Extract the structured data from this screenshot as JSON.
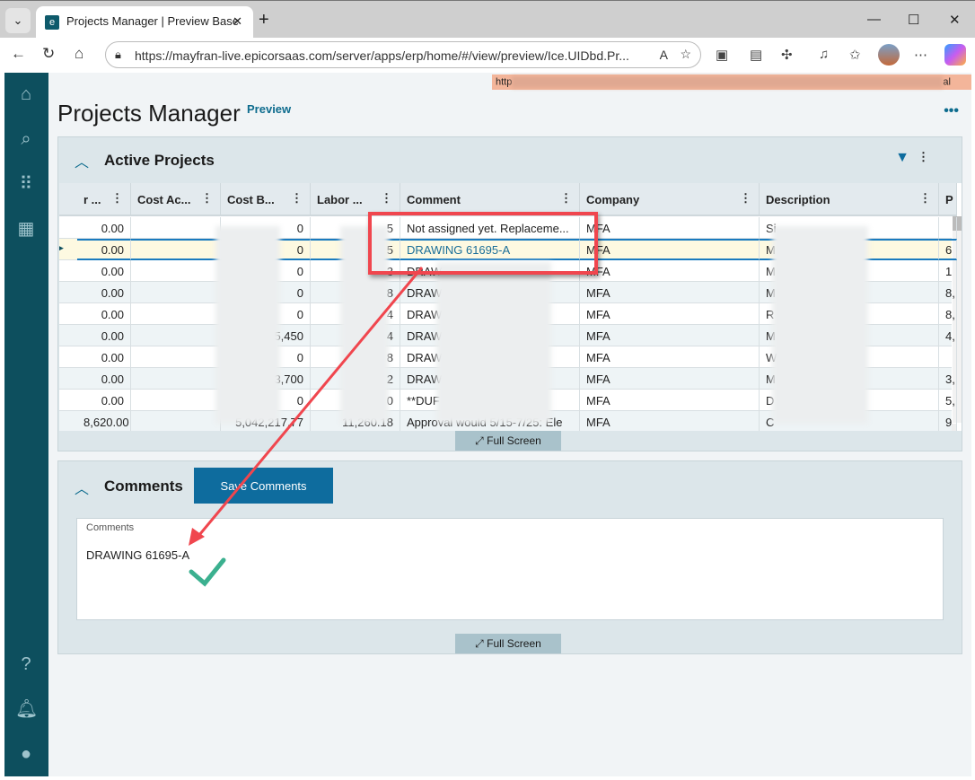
{
  "browser": {
    "tab_title": "Projects Manager | Preview Base",
    "url": "https://mayfran-live.epicorsaas.com/server/apps/erp/home/#/view/preview/Ice.UIDbd.Pr...",
    "banner_start": "http",
    "banner_end": "al"
  },
  "page": {
    "title": "Projects Manager",
    "badge": "Preview"
  },
  "grid": {
    "title": "Active Projects",
    "columns": [
      "r ...",
      "Cost Ac...",
      "Cost B...",
      "Labor ...",
      "Comment",
      "Company",
      "Description",
      "P"
    ],
    "rows": [
      {
        "c1": "0.00",
        "c3": "0",
        "c4": "5",
        "comment": "Not assigned yet. Replaceme...",
        "company": "MFA",
        "desc": "Si",
        "p": ""
      },
      {
        "c1": "0.00",
        "c3": "0",
        "c4": "5",
        "comment": "DRAWING 61695-A",
        "company": "MFA",
        "desc": "M",
        "p": "6"
      },
      {
        "c1": "0.00",
        "c3": "0",
        "c4": "3",
        "comment": "DRAW",
        "company": "MFA",
        "desc": "M",
        "p": "1"
      },
      {
        "c1": "0.00",
        "c3": "0",
        "c4": "8",
        "comment": "DRAW",
        "company": "MFA",
        "desc": "M",
        "p": "8,"
      },
      {
        "c1": "0.00",
        "c3": "0",
        "c4": "4",
        "comment": "DRAW",
        "company": "MFA",
        "desc": "R",
        "p": "8,"
      },
      {
        "c1": "0.00",
        "c3": "5,450",
        "c4": "4",
        "comment": "DRAW",
        "company": "MFA",
        "desc": "M",
        "p": "4,"
      },
      {
        "c1": "0.00",
        "c3": "0",
        "c4": "8",
        "comment": "DRAW",
        "company": "MFA",
        "desc": "W",
        "p": ""
      },
      {
        "c1": "0.00",
        "c3": "3,700",
        "c4": "2",
        "comment": "DRAW",
        "company": "MFA",
        "desc": "M",
        "p": "3,"
      },
      {
        "c1": "0.00",
        "c3": "0",
        "c4": "0",
        "comment": "**DUF",
        "company": "MFA",
        "desc": "D",
        "p": "5,"
      },
      {
        "c1": "8,620.00",
        "c3": "5,042,217.77",
        "c4": "11,260.18",
        "comment": "Approval would 5/15-7/25: Ele",
        "company": "MFA",
        "desc": "C",
        "p": "9"
      }
    ],
    "full_screen": "Full Screen"
  },
  "comments": {
    "title": "Comments",
    "save_button": "Save Comments",
    "field_label": "Comments",
    "field_value": "DRAWING 61695-A",
    "full_screen": "Full Screen"
  },
  "colors": {
    "sidebar": "#0d4f5e",
    "accent": "#0e6c9e",
    "annotation": "#f0464e",
    "check": "#3bb08f"
  }
}
